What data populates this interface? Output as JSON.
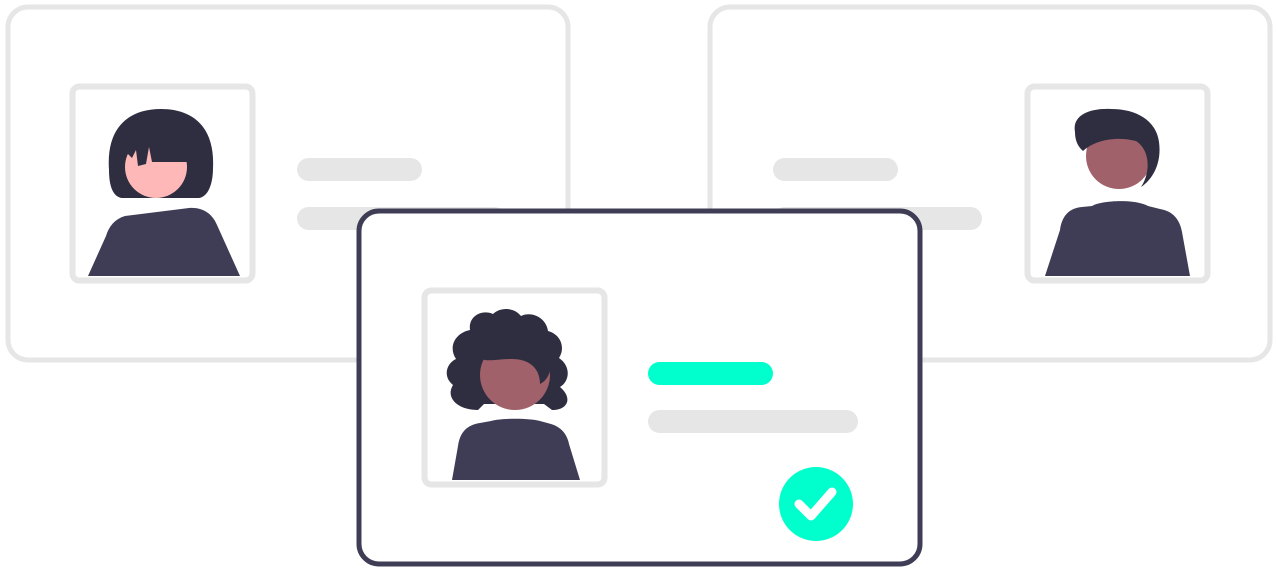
{
  "colors": {
    "card_border_inactive": "#e6e6e6",
    "card_border_active": "#3f3d56",
    "card_fill": "#ffffff",
    "text_placeholder": "#e6e6e6",
    "accent": "#00ffcc",
    "check_mark": "#ffffff",
    "hair_dark": "#2f2e41",
    "shirt": "#3f3d56",
    "skin_light": "#ffb8b8",
    "skin_dark": "#a0616a"
  },
  "cards": [
    {
      "state": "inactive",
      "avatar": "woman-short-hair"
    },
    {
      "state": "inactive",
      "avatar": "man"
    },
    {
      "state": "selected",
      "avatar": "woman-curly-hair",
      "badge_icon": "check-icon"
    }
  ]
}
